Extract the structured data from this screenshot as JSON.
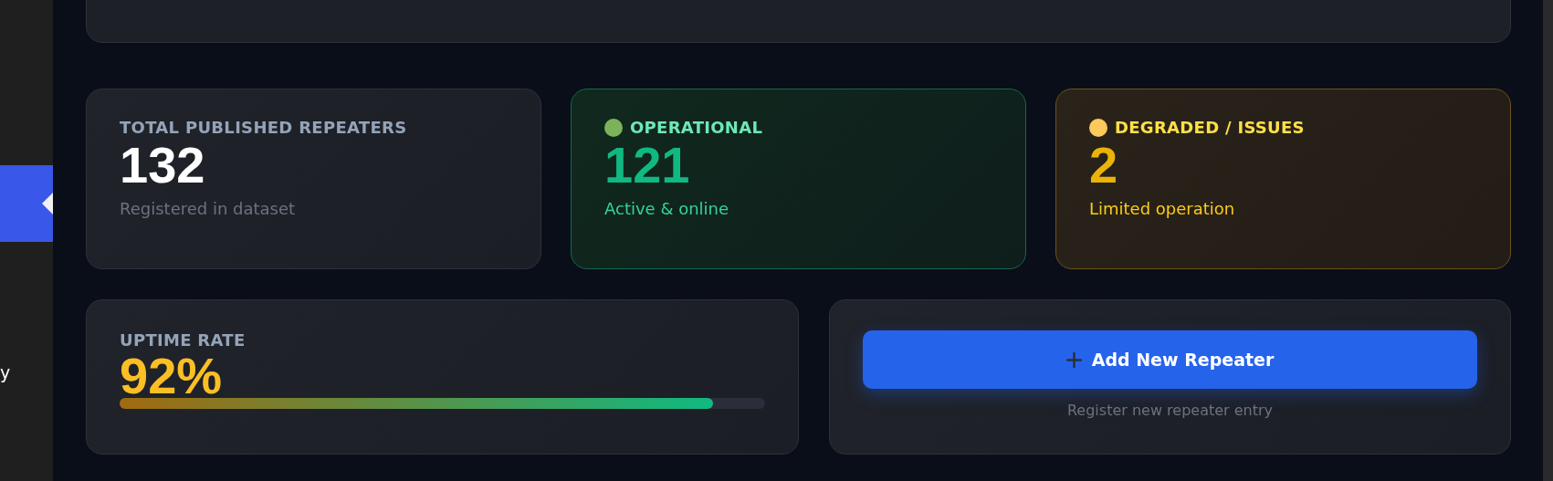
{
  "sidebar": {
    "items": [
      {
        "selected": true
      },
      {
        "label": "y",
        "selected": false
      }
    ]
  },
  "stats": [
    {
      "kind": "total",
      "label": "TOTAL PUBLISHED REPEATERS",
      "value": "132",
      "caption": "Registered in dataset"
    },
    {
      "kind": "operational",
      "label": "OPERATIONAL",
      "value": "121",
      "caption": "Active & online",
      "color": "#7cb35a"
    },
    {
      "kind": "degraded",
      "label": "DEGRADED / ISSUES",
      "value": "2",
      "caption": "Limited operation",
      "color": "#fcc95a"
    }
  ],
  "uptime": {
    "label": "UPTIME RATE",
    "value": "92%",
    "level": 0.92
  },
  "add_card": {
    "button": "Add New Repeater",
    "caption": "Register new repeater entry"
  }
}
